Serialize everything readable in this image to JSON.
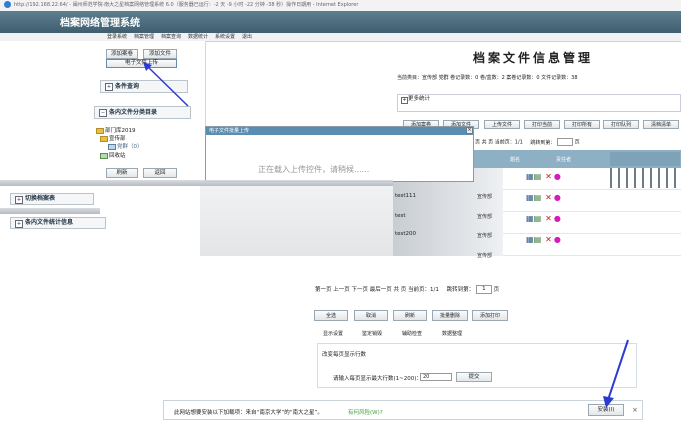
{
  "window": {
    "title": "http://192.168.22.64/ - 闽州师范学院·南大之星档案网络管理系统 6.0（服务器已运行：-2 天 -9 小时 -22 分钟 -38 秒）操作日期用 - Internet Explorer"
  },
  "app": {
    "title": "档案网络管理系统"
  },
  "nav": {
    "items": [
      "登录系统",
      "档案管理",
      "档案查询",
      "数据统计",
      "系统设置",
      "退出"
    ]
  },
  "left": {
    "add_volume": "添加案卷",
    "add_file": "添加文件",
    "upload": "电子文件上传",
    "query_header": "条件查询",
    "category_header": "条内文件分类目录",
    "tree": {
      "root": "部门库2019",
      "child": "宣传部",
      "leaf": "党群（0）",
      "recycle": "回收站"
    },
    "refresh": "刷新",
    "back": "返回",
    "switch_table": "切换档案表",
    "file_stats": "条内文件统计信息"
  },
  "main": {
    "title": "档案文件信息管理",
    "stats": "当前类目：宣传部 党群  卷记录数：0 卷/盒数：2 案卷记录数：0 文件记录数：38",
    "more_stats": "更多统计",
    "toolbar": [
      "添加案卷",
      "添加文件",
      "上传文件",
      "打印当前",
      "打印所有",
      "打印队列",
      "清档清单"
    ],
    "pager_top": "页  共 页 当前页：1/1",
    "jump_to": "跳转到第：",
    "jump_suffix": "页",
    "col_name": "题名",
    "col_owner": "责任者",
    "rows": [
      {
        "title": "test",
        "dept": "宣传部",
        "no": "1"
      },
      {
        "title": "test111",
        "dept": "宣传部",
        "no": "1"
      },
      {
        "title": "test",
        "dept": "宣传部",
        "no": "1"
      },
      {
        "title": "test200",
        "dept": "宣传部",
        "no": "1"
      }
    ],
    "row_prefix": "号",
    "pager_bottom": "第一页 上一页 下一页 最后一页  共 页 当前页：1/1",
    "jump_bottom": "跳转到第：",
    "jump_bottom_value": "1",
    "jump_bottom_suffix": "页",
    "actions": [
      "全选",
      "取消",
      "刷新",
      "批量删除",
      "添加打印"
    ],
    "tabs": [
      "显示设置",
      "鉴定销毁",
      "辅助检查",
      "数据整理"
    ],
    "setting_title": "改变每页显示行数",
    "setting_label": "请输入每页显示最大行数(1~200)：",
    "setting_value": "20",
    "setting_submit": "提交"
  },
  "dialog": {
    "title": "电子文件批量上传",
    "loading": "正在载入上传控件，请稍候......"
  },
  "notify": {
    "text": "此网站想要安装以下加载项：来自“南京大学”的“南大之星”。",
    "risk": "有何风险(W)?",
    "install": "安装(I)",
    "close": "×"
  },
  "colors": {
    "banner": "#4a6b7c",
    "grid_header": "#8eb0c4",
    "arrow": "#2b3bd1",
    "dialog_title": "#5b8db0",
    "risk_link": "#3aa13a"
  }
}
